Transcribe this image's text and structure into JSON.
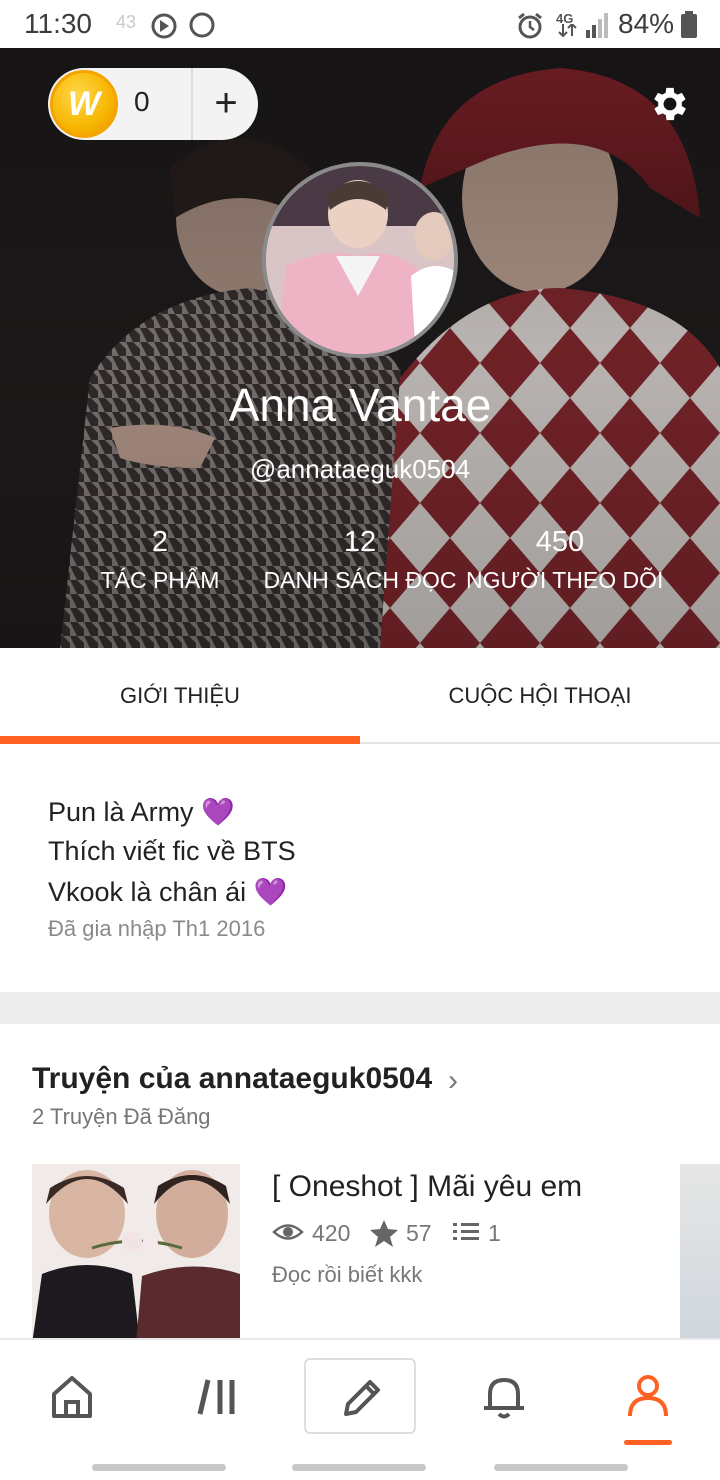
{
  "status_bar": {
    "time": "11:30",
    "ghost": "43",
    "network": "4G",
    "battery": "84%"
  },
  "header": {
    "coins": "0",
    "coin_symbol": "W",
    "add_label": "+",
    "name": "Anna Vantae",
    "handle": "@annataeguk0504",
    "stats": [
      {
        "value": "2",
        "label": "TÁC PHẨM"
      },
      {
        "value": "12",
        "label": "DANH SÁCH ĐỌC"
      },
      {
        "value": "450",
        "label": "NGƯỜI THEO DÕI"
      }
    ]
  },
  "tabs": [
    {
      "label": "GIỚI THIỆU",
      "active": true
    },
    {
      "label": "CUỘC HỘI THOẠI",
      "active": false
    }
  ],
  "about": {
    "lines": [
      {
        "text": "Pun là Army ",
        "emoji": "💜"
      },
      {
        "text": "Thích viết fic về BTS",
        "emoji": ""
      },
      {
        "text": "Vkook là chân ái ",
        "emoji": "💜"
      }
    ],
    "joined": "Đã gia nhập Th1 2016"
  },
  "stories": {
    "title": "Truyện của annataeguk0504",
    "chevron": "›",
    "subtitle": "2 Truyện Đã Đăng",
    "items": [
      {
        "title": "[ Oneshot ] Mãi yêu em",
        "views": "420",
        "votes": "57",
        "parts": "1",
        "description": "Đọc rồi biết kkk"
      }
    ]
  },
  "bottom_nav": {
    "items": [
      "home-icon",
      "library-icon",
      "pencil-icon",
      "bell-icon",
      "profile-icon"
    ],
    "active": "profile-icon"
  },
  "colors": {
    "accent": "#ff6122",
    "heart": "#a62ddb",
    "coin": "#f7b500"
  }
}
